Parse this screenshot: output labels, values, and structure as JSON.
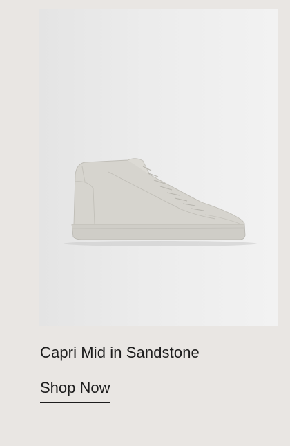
{
  "product": {
    "image_alt": "sneaker-image",
    "title": "Capri Mid in Sandstone",
    "cta_label": "Shop Now"
  },
  "colors": {
    "page_background": "#e9e6e3",
    "image_background": "#ececec",
    "text": "#1d1d1d",
    "shoe": "#d2d0ca"
  }
}
